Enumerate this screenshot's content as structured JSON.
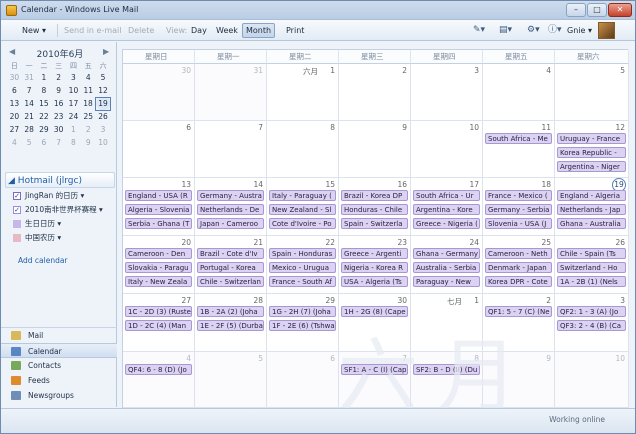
{
  "window": {
    "title": "Calendar - Windows Live Mail"
  },
  "toolbar": {
    "new": "New ▾",
    "send_email": "Send in e-mail",
    "delete": "Delete",
    "view": "View:",
    "day": "Day",
    "week": "Week",
    "month": "Month",
    "print": "Print",
    "user": "Gnie ▾"
  },
  "mini_calendar": {
    "title": "2010年6月",
    "weekdays": [
      "日",
      "一",
      "二",
      "三",
      "四",
      "五",
      "六"
    ],
    "rows": [
      [
        "30",
        "31",
        "1",
        "2",
        "3",
        "4",
        "5"
      ],
      [
        "6",
        "7",
        "8",
        "9",
        "10",
        "11",
        "12"
      ],
      [
        "13",
        "14",
        "15",
        "16",
        "17",
        "18",
        "19"
      ],
      [
        "20",
        "21",
        "22",
        "23",
        "24",
        "25",
        "26"
      ],
      [
        "27",
        "28",
        "29",
        "30",
        "1",
        "2",
        "3"
      ],
      [
        "4",
        "5",
        "6",
        "7",
        "8",
        "9",
        "10"
      ]
    ],
    "today": "19"
  },
  "calendars": {
    "account": "Hotmail (jlrgc)",
    "items": [
      {
        "label": "JingRan 的日历 ▾",
        "checked": true,
        "color": "#7a6ac6"
      },
      {
        "label": "2010南非世界杯赛程 ▾",
        "checked": true,
        "color": "#9c8cd9"
      },
      {
        "label": "生日日历 ▾",
        "checked": false,
        "color": "#c7b6e9"
      },
      {
        "label": "中国农历 ▾",
        "checked": false,
        "color": "#e7b8c6"
      }
    ],
    "add": "Add calendar"
  },
  "nav": [
    "Mail",
    "Calendar",
    "Contacts",
    "Feeds",
    "Newsgroups"
  ],
  "month_view": {
    "weekday_headers": [
      "星期日",
      "星期一",
      "星期二",
      "星期三",
      "星期四",
      "星期五",
      "星期六"
    ],
    "month_label_jun": "六月",
    "month_label_jul": "七月",
    "weeks": [
      [
        {
          "d": "30",
          "o": true,
          "ev": []
        },
        {
          "d": "31",
          "o": true,
          "ev": []
        },
        {
          "d": "1",
          "m": "六月",
          "ev": []
        },
        {
          "d": "2",
          "ev": []
        },
        {
          "d": "3",
          "ev": []
        },
        {
          "d": "4",
          "ev": []
        },
        {
          "d": "5",
          "ev": []
        }
      ],
      [
        {
          "d": "6",
          "ev": []
        },
        {
          "d": "7",
          "ev": []
        },
        {
          "d": "8",
          "ev": []
        },
        {
          "d": "9",
          "ev": []
        },
        {
          "d": "10",
          "ev": []
        },
        {
          "d": "11",
          "ev": [
            "South Africa - Me"
          ]
        },
        {
          "d": "12",
          "ev": [
            "Uruguay - France",
            "Korea Republic -",
            "Argentina - Niger"
          ]
        }
      ],
      [
        {
          "d": "13",
          "ev": [
            "England - USA (R",
            "Algeria - Slovenia",
            "Serbia - Ghana (T"
          ]
        },
        {
          "d": "14",
          "ev": [
            "Germany - Austra",
            "Netherlands - De",
            "Japan - Cameroo"
          ]
        },
        {
          "d": "15",
          "ev": [
            "Italy - Paraguay (",
            "New Zealand - Sl",
            "Cote d'Ivoire - Po"
          ]
        },
        {
          "d": "16",
          "ev": [
            "Brazil - Korea DP",
            "Honduras - Chile",
            "Spain - Switzerla"
          ]
        },
        {
          "d": "17",
          "ev": [
            "South Africa - Ur",
            "Argentina - Kore",
            "Greece - Nigeria ("
          ]
        },
        {
          "d": "18",
          "ev": [
            "France - Mexico (",
            "Germany - Serbia",
            "Slovenia - USA (J"
          ]
        },
        {
          "d": "19",
          "today": true,
          "ev": [
            "England - Algeria",
            "Netherlands - Jap",
            "Ghana - Australia"
          ]
        }
      ],
      [
        {
          "d": "20",
          "ev": [
            "Cameroon - Den",
            "Slovakia - Paragu",
            "Italy - New Zeala"
          ]
        },
        {
          "d": "21",
          "ev": [
            "Brazil - Cote d'Iv",
            "Portugal - Korea",
            "Chile - Switzerlan"
          ]
        },
        {
          "d": "22",
          "ev": [
            "Spain - Honduras",
            "Mexico - Urugua",
            "France - South Af"
          ]
        },
        {
          "d": "23",
          "ev": [
            "Greece - Argenti",
            "Nigeria - Korea R",
            "USA - Algeria (Ts"
          ]
        },
        {
          "d": "24",
          "ev": [
            "Ghana - Germany",
            "Australia - Serbia",
            "Paraguay - New"
          ]
        },
        {
          "d": "25",
          "ev": [
            "Cameroon - Neth",
            "Denmark - Japan",
            "Korea DPR - Cote"
          ]
        },
        {
          "d": "26",
          "ev": [
            "Chile - Spain (Ts",
            "Switzerland - Ho",
            "1A - 2B (1) (Nels"
          ]
        }
      ],
      [
        {
          "d": "27",
          "ev": [
            "1C - 2D (3) (Ruste",
            "1D - 2C (4) (Man"
          ]
        },
        {
          "d": "28",
          "ev": [
            "1B - 2A (2) (Joha",
            "1E - 2F (5) (Durba"
          ]
        },
        {
          "d": "29",
          "ev": [
            "1G - 2H (7) (Joha",
            "1F - 2E (6) (Tshwa"
          ]
        },
        {
          "d": "30",
          "ev": [
            "1H - 2G (8) (Cape"
          ]
        },
        {
          "d": "1",
          "m": "七月",
          "ev": []
        },
        {
          "d": "2",
          "ev": [
            "QF1: 5 - 7 (C) (Ne"
          ]
        },
        {
          "d": "3",
          "ev": [
            "QF2: 1 - 3 (A) (Jo",
            "QF3: 2 - 4 (B) (Ca"
          ]
        }
      ],
      [
        {
          "d": "4",
          "o": true,
          "ev": [
            "QF4: 6 - 8 (D) (Jo"
          ]
        },
        {
          "d": "5",
          "o": true,
          "ev": []
        },
        {
          "d": "6",
          "o": true,
          "ev": []
        },
        {
          "d": "7",
          "o": true,
          "ev": [
            "SF1: A - C (I) (Cap"
          ]
        },
        {
          "d": "8",
          "o": true,
          "ev": [
            "SF2: B - D (II) (Du"
          ]
        },
        {
          "d": "9",
          "o": true,
          "ev": []
        },
        {
          "d": "10",
          "o": true,
          "ev": []
        }
      ]
    ]
  },
  "watermark": "六月",
  "status": "Working online"
}
